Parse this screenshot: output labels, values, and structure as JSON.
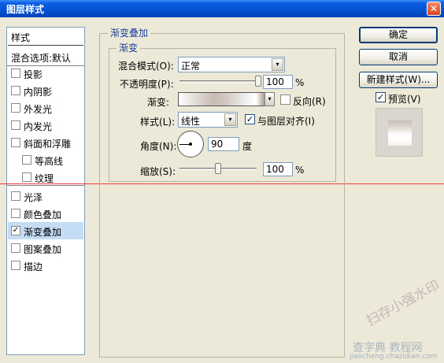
{
  "window": {
    "title": "图层样式",
    "close_glyph": "✕"
  },
  "left_panel": {
    "header": "样式",
    "blend_options": "混合选项:默认",
    "items": [
      {
        "label": "投影",
        "checked": false
      },
      {
        "label": "内阴影",
        "checked": false
      },
      {
        "label": "外发光",
        "checked": false
      },
      {
        "label": "内发光",
        "checked": false
      },
      {
        "label": "斜面和浮雕",
        "checked": false
      },
      {
        "label": "等高线",
        "checked": false
      },
      {
        "label": "纹理",
        "checked": false
      },
      {
        "label": "光泽",
        "checked": false
      },
      {
        "label": "颜色叠加",
        "checked": false
      },
      {
        "label": "渐变叠加",
        "checked": true
      },
      {
        "label": "图案叠加",
        "checked": false
      },
      {
        "label": "描边",
        "checked": false
      }
    ]
  },
  "main": {
    "section_title": "渐变叠加",
    "group_title": "渐变",
    "blend_mode_label": "混合模式(O):",
    "blend_mode_value": "正常",
    "opacity_label": "不透明度(P):",
    "opacity_value": "100",
    "opacity_percent": 100,
    "unit_percent": "%",
    "gradient_label": "渐变:",
    "reverse_label": "反向(R)",
    "reverse_checked": false,
    "style_label": "样式(L):",
    "style_value": "线性",
    "align_label": "与图层对齐(I)",
    "align_checked": true,
    "angle_label": "角度(N):",
    "angle_value": "90",
    "angle_unit": "度",
    "scale_label": "缩放(S):",
    "scale_value": "100",
    "scale_percent": 100
  },
  "buttons": {
    "ok": "确定",
    "cancel": "取消",
    "new_style": "新建样式(W)...",
    "preview_label": "预览(V)",
    "preview_checked": true
  },
  "watermark": {
    "stamp": "扫存小强水印",
    "site": "查字典 教程网",
    "url": "jiaocheng.chazidian.com"
  },
  "icons": {
    "checkmark": "✓",
    "dropdown": "▾"
  },
  "colors": {
    "titlebar": "#0654d6",
    "selected_row": "#c4dcf4",
    "red_guide": "#e83a3a"
  }
}
